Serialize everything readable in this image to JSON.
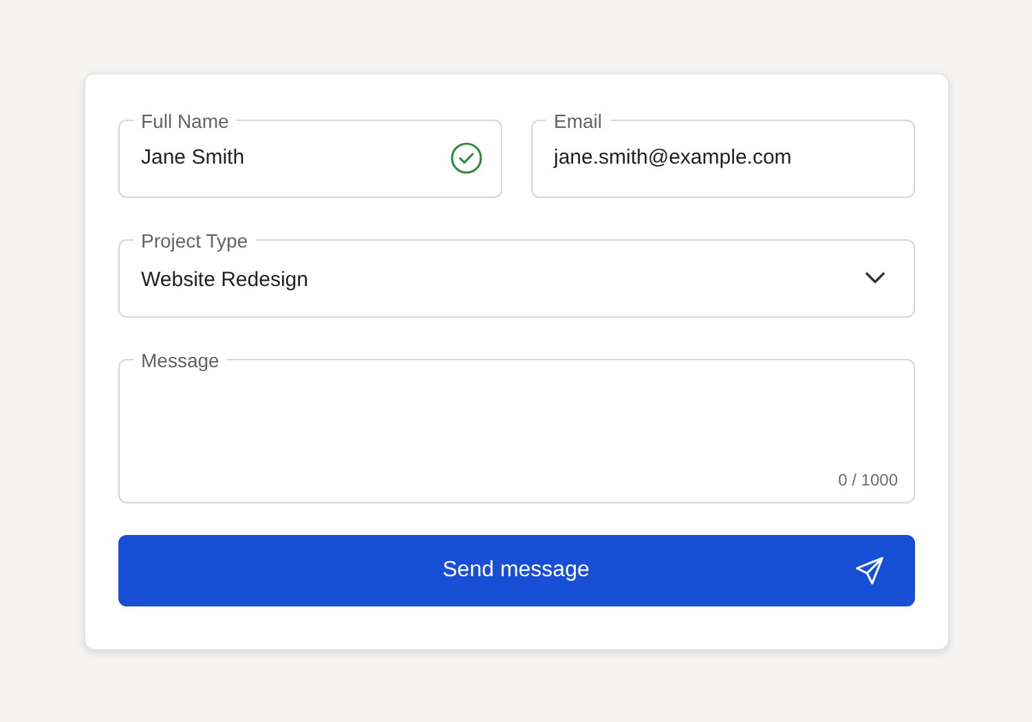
{
  "fields": [
    {
      "label": "Full Name",
      "value": "Jane Smith",
      "valid": true
    },
    {
      "label": "Email",
      "value": "jane.smith@example.com",
      "valid": false
    }
  ],
  "project_type": {
    "label": "Project Type",
    "value": "Website Redesign"
  },
  "message": {
    "label": "Message",
    "counter": "0 / 1000"
  },
  "submit": {
    "label": "Send message"
  }
}
